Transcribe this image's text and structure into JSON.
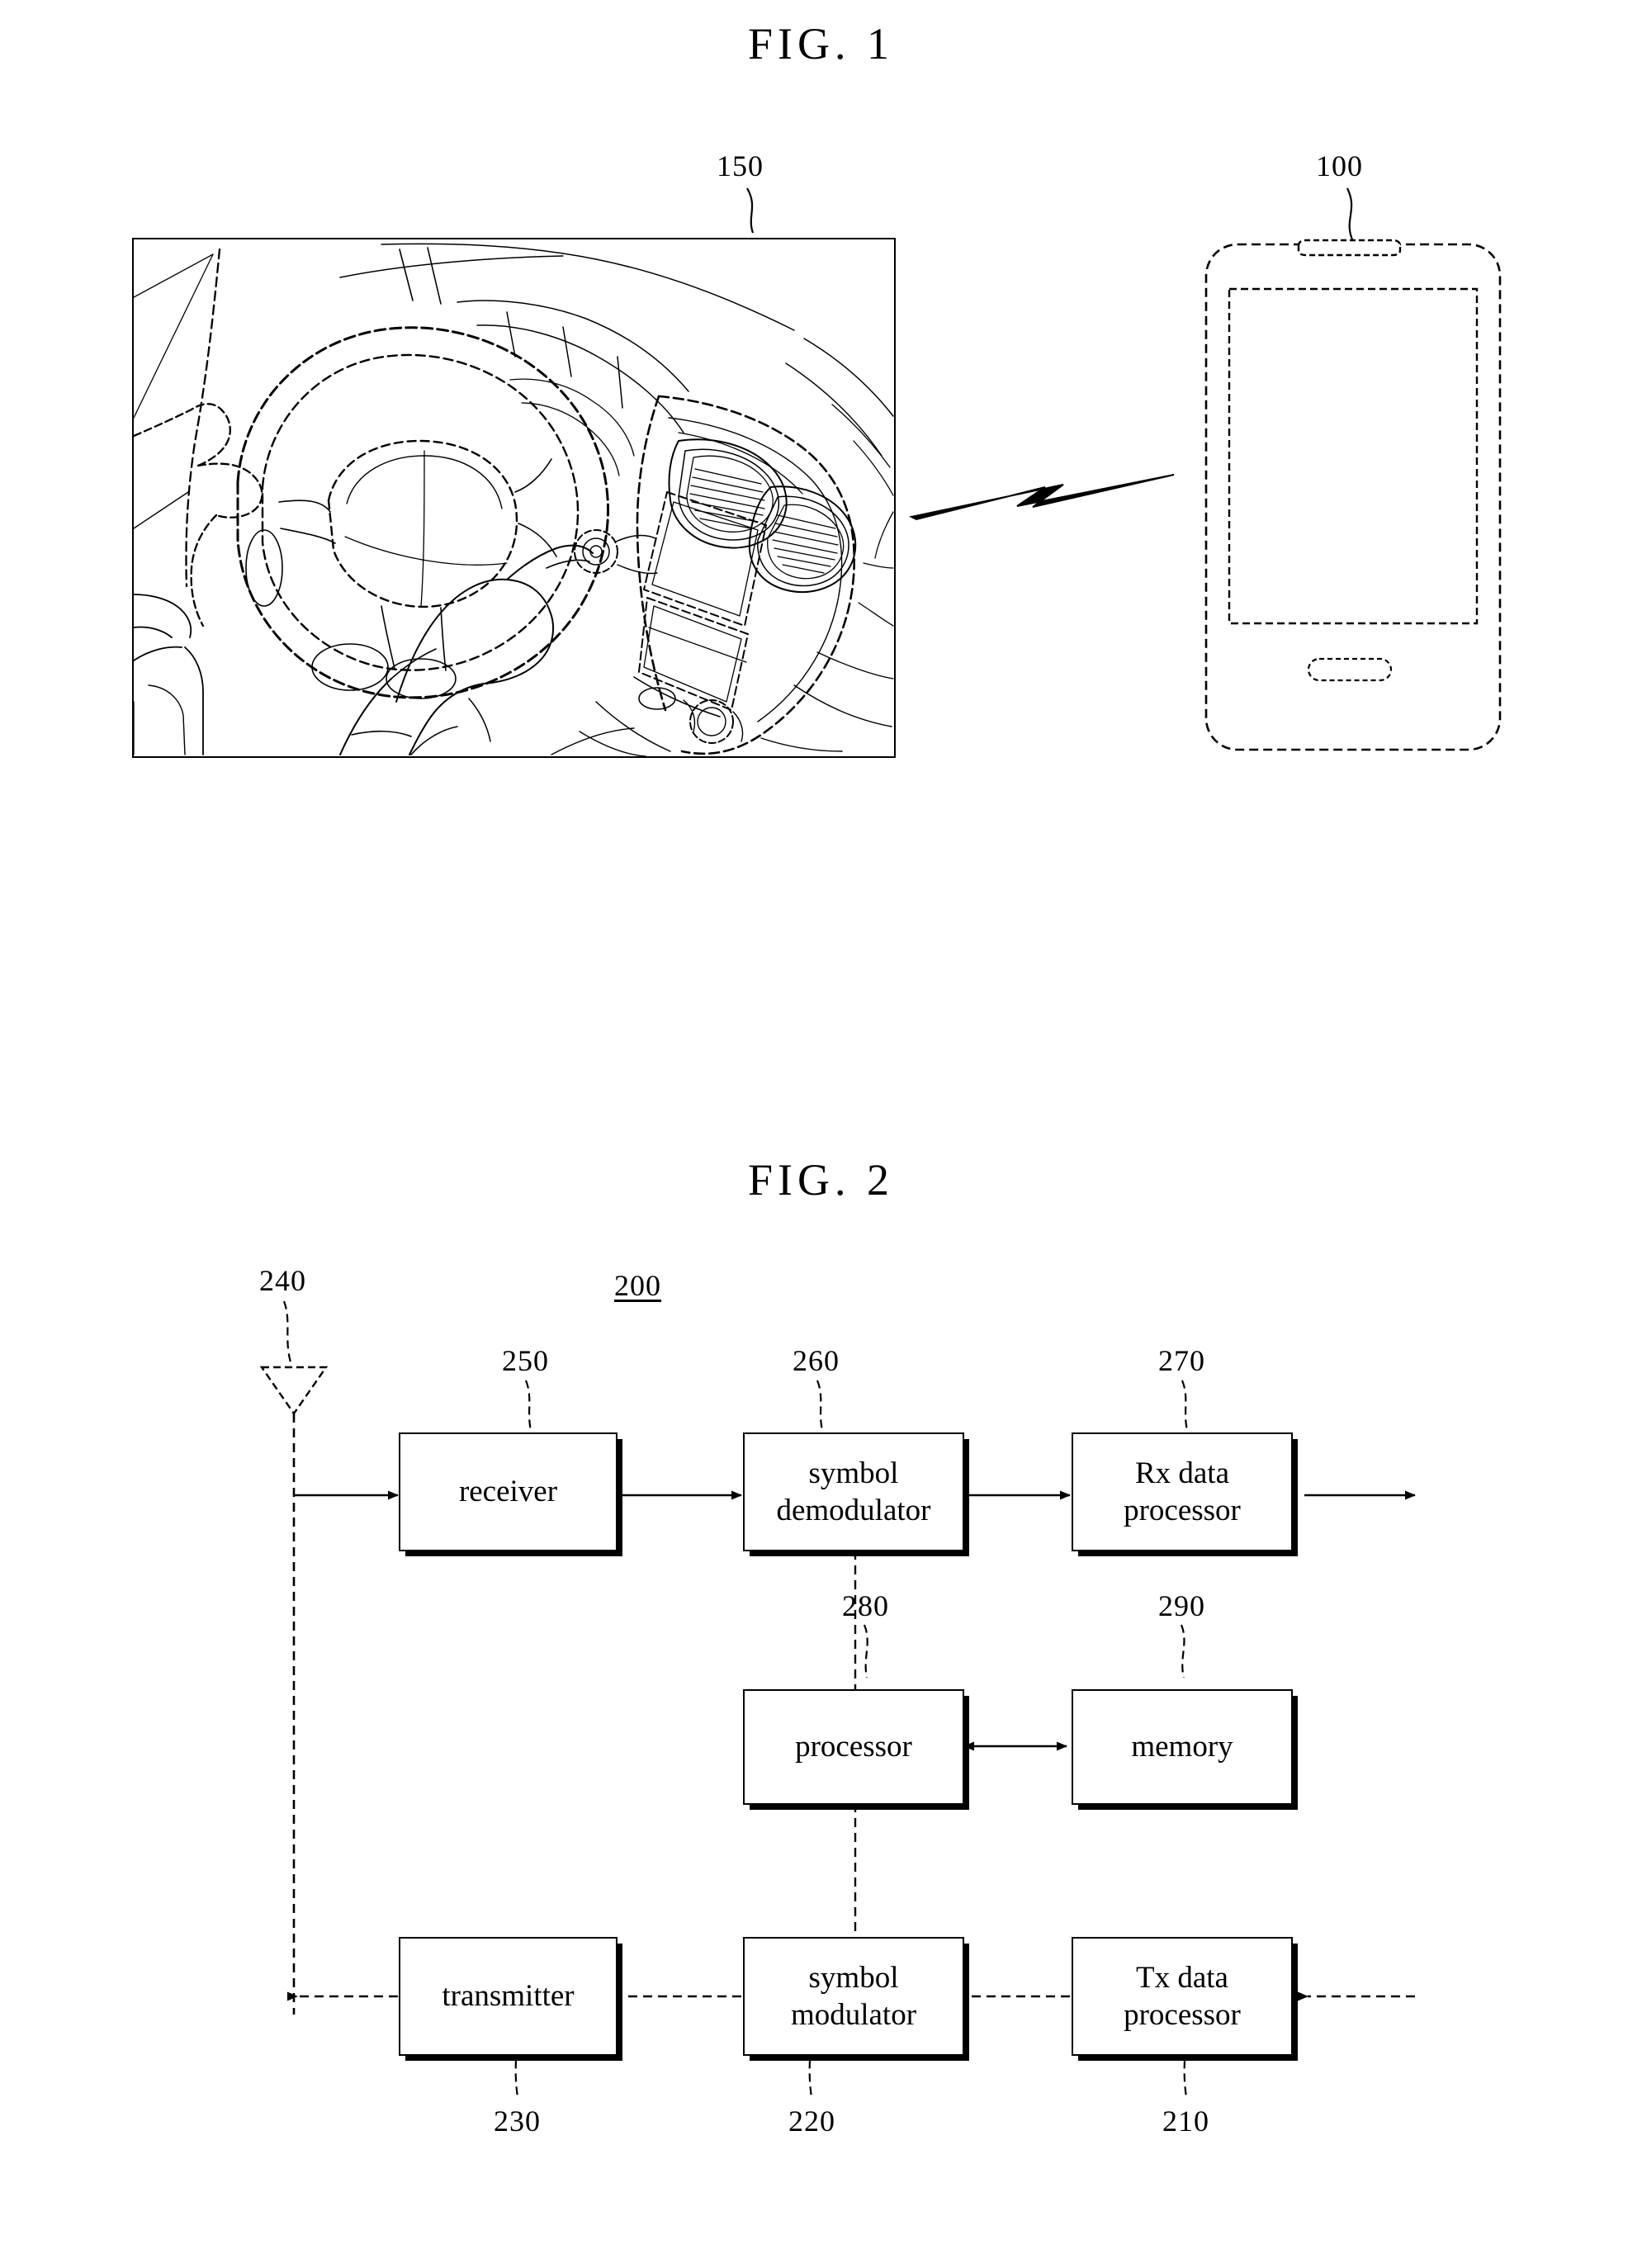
{
  "figures": [
    {
      "id": "fig1",
      "title": "FIG. 1",
      "description": "Vehicle interior with steering wheel and hands, center console with air vents and display, wirelessly linked to a smartphone",
      "refs": [
        {
          "name": "vehicle-ref",
          "label": "150"
        },
        {
          "name": "terminal-ref",
          "label": "100"
        }
      ],
      "elements": {
        "vehicle_scene": "car-interior-line-drawing",
        "wireless_link": "lightning-bolt-icon",
        "mobile_terminal": "smartphone-outline"
      }
    },
    {
      "id": "fig2",
      "title": "FIG. 2",
      "system_ref": "200",
      "antenna_ref": "240",
      "blocks": [
        {
          "name": "receiver",
          "label": "receiver",
          "ref": "250"
        },
        {
          "name": "symbol-demodulator",
          "label": "symbol\ndemodulator",
          "ref": "260"
        },
        {
          "name": "rx-data-processor",
          "label": "Rx data\nprocessor",
          "ref": "270"
        },
        {
          "name": "processor",
          "label": "processor",
          "ref": "280"
        },
        {
          "name": "memory",
          "label": "memory",
          "ref": "290"
        },
        {
          "name": "transmitter",
          "label": "transmitter",
          "ref": "230"
        },
        {
          "name": "symbol-modulator",
          "label": "symbol\nmodulator",
          "ref": "220"
        },
        {
          "name": "tx-data-processor",
          "label": "Tx data\nprocessor",
          "ref": "210"
        }
      ]
    }
  ],
  "fig1": {
    "title": "FIG. 1",
    "ref_150": "150",
    "ref_100": "100"
  },
  "fig2": {
    "title": "FIG. 2",
    "ref_200": "200",
    "ref_240": "240",
    "ref_250": "250",
    "ref_260": "260",
    "ref_270": "270",
    "ref_280": "280",
    "ref_290": "290",
    "ref_230": "230",
    "ref_220": "220",
    "ref_210": "210",
    "blocks": {
      "receiver": "receiver",
      "symbol_demodulator_line1": "symbol",
      "symbol_demodulator_line2": "demodulator",
      "rx_data_processor_line1": "Rx data",
      "rx_data_processor_line2": "processor",
      "processor": "processor",
      "memory": "memory",
      "transmitter": "transmitter",
      "symbol_modulator_line1": "symbol",
      "symbol_modulator_line2": "modulator",
      "tx_data_processor_line1": "Tx data",
      "tx_data_processor_line2": "processor"
    }
  },
  "colors": {
    "ink": "#000000",
    "paper": "#ffffff"
  }
}
